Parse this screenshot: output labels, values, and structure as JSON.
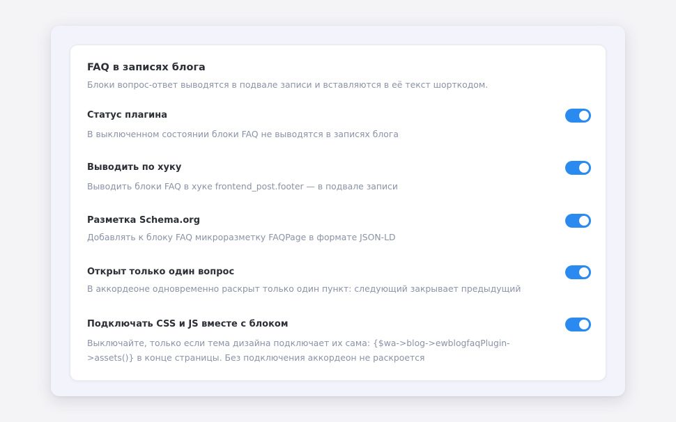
{
  "panel": {
    "title": "FAQ в записях блога",
    "subtitle": "Блоки вопрос-ответ выводятся в подвале записи и вставляются в её текст шорткодом."
  },
  "settings": [
    {
      "label": "Статус плагина",
      "description": "В выключенном состоянии блоки FAQ не выводятся в записях блога",
      "enabled": true
    },
    {
      "label": "Выводить по хуку",
      "description": "Выводить блоки FAQ в хуке frontend_post.footer — в подвале записи",
      "enabled": true
    },
    {
      "label": "Разметка Schema.org",
      "description": "Добавлять к блоку FAQ микроразметку FAQPage в формате JSON-LD",
      "enabled": true
    },
    {
      "label": "Открыт только один вопрос",
      "description": "В аккордеоне одновременно раскрыт только один пункт: следующий закрывает предыдущий",
      "enabled": true
    },
    {
      "label": "Подключать CSS и JS вместе с блоком",
      "description": "Выключайте, только если тема дизайна подключает их сама: {$wa->blog->ewblogfaqPlugin->assets()} в конце страницы. Без подключения аккордеон не раскроется",
      "enabled": true
    }
  ],
  "colors": {
    "toggle_on": "#2b8af0",
    "label": "#2c2f36",
    "muted": "#8a92a6"
  }
}
